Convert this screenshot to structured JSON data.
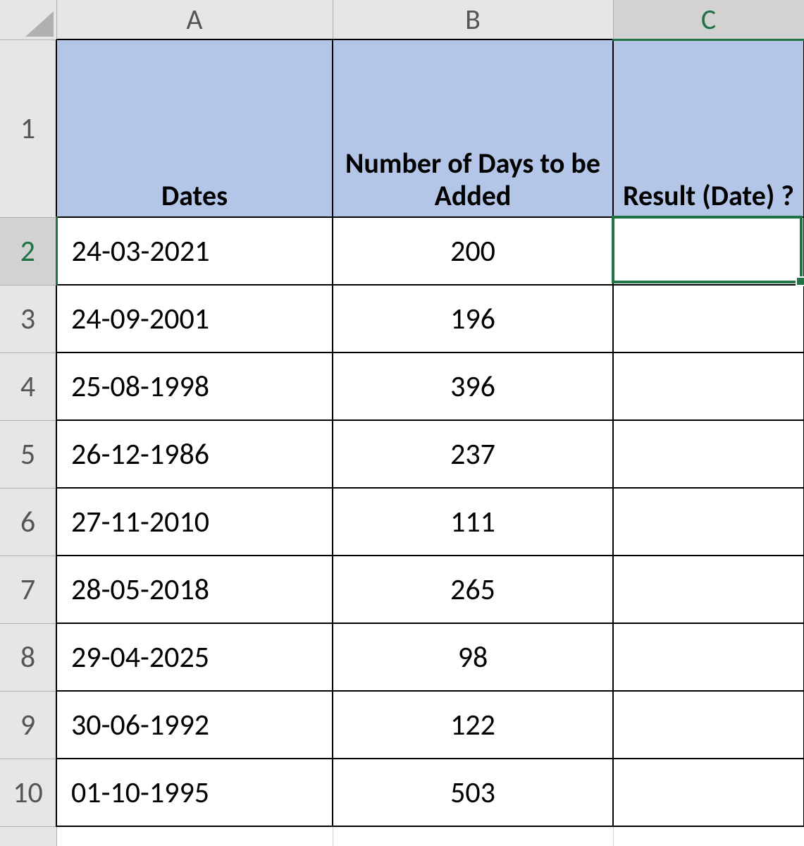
{
  "columns": [
    "A",
    "B",
    "C"
  ],
  "row_numbers": [
    "1",
    "2",
    "3",
    "4",
    "5",
    "6",
    "7",
    "8",
    "9",
    "10"
  ],
  "headers": {
    "A": "Dates",
    "B": "Number of Days to be Added",
    "C": "Result (Date) ?"
  },
  "rows": [
    {
      "date": "24-03-2021",
      "days": "200",
      "result": ""
    },
    {
      "date": "24-09-2001",
      "days": "196",
      "result": ""
    },
    {
      "date": "25-08-1998",
      "days": "396",
      "result": ""
    },
    {
      "date": "26-12-1986",
      "days": "237",
      "result": ""
    },
    {
      "date": "27-11-2010",
      "days": "111",
      "result": ""
    },
    {
      "date": "28-05-2018",
      "days": "265",
      "result": ""
    },
    {
      "date": "29-04-2025",
      "days": "98",
      "result": ""
    },
    {
      "date": "30-06-1992",
      "days": "122",
      "result": ""
    },
    {
      "date": "01-10-1995",
      "days": "503",
      "result": ""
    }
  ],
  "selected_cell": "C2",
  "colors": {
    "header_fill": "#b4c6e7",
    "selection": "#217346",
    "grid_bg": "#e6e6e6"
  }
}
